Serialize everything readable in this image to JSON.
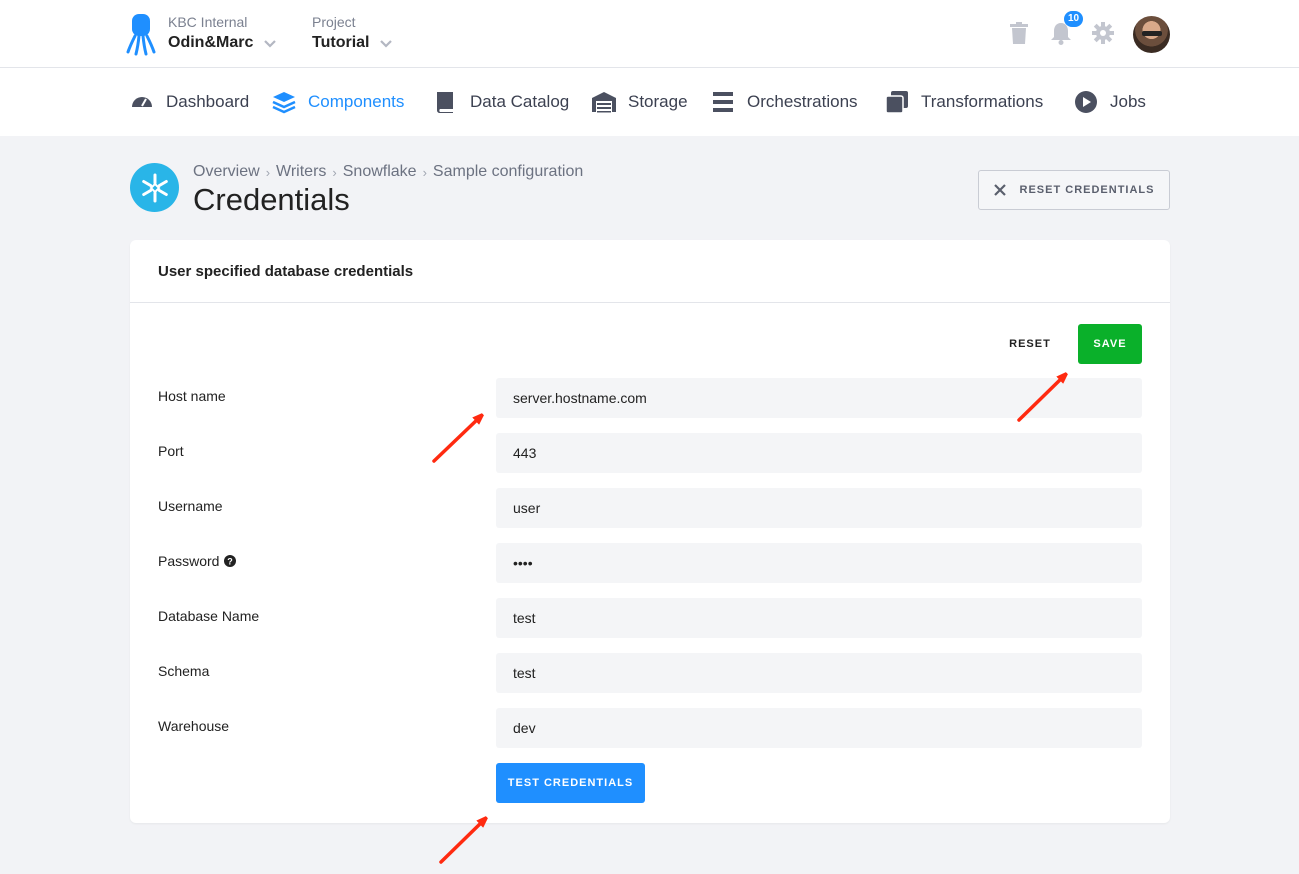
{
  "topbar": {
    "organization_label": "KBC Internal",
    "organization_name": "Odin&Marc",
    "project_label": "Project",
    "project_name": "Tutorial",
    "notifications_count": "10",
    "icons": [
      "trash-icon",
      "bell-icon",
      "gear-icon"
    ]
  },
  "nav": {
    "items": [
      {
        "label": "Dashboard",
        "icon": "gauge-icon"
      },
      {
        "label": "Components",
        "icon": "layers-icon"
      },
      {
        "label": "Data Catalog",
        "icon": "book-icon"
      },
      {
        "label": "Storage",
        "icon": "warehouse-icon"
      },
      {
        "label": "Orchestrations",
        "icon": "bars-icon"
      },
      {
        "label": "Transformations",
        "icon": "copy-icon"
      },
      {
        "label": "Jobs",
        "icon": "play-circle-icon"
      }
    ],
    "active": "Components"
  },
  "header": {
    "breadcrumb": [
      "Overview",
      "Writers",
      "Snowflake",
      "Sample configuration"
    ],
    "title": "Credentials",
    "reset_credentials_label": "RESET CREDENTIALS"
  },
  "card": {
    "title": "User specified database credentials",
    "reset_label": "RESET",
    "save_label": "SAVE",
    "fields": [
      {
        "label": "Host name",
        "value": "server.hostname.com"
      },
      {
        "label": "Port",
        "value": "443"
      },
      {
        "label": "Username",
        "value": "user"
      },
      {
        "label": "Password",
        "value": "••••"
      },
      {
        "label": "Database Name",
        "value": "test"
      },
      {
        "label": "Schema",
        "value": "test"
      },
      {
        "label": "Warehouse",
        "value": "dev"
      }
    ],
    "test_credentials_label": "TEST CREDENTIALS"
  },
  "colors": {
    "accent": "#1f8fff",
    "save": "#0ab02a",
    "annotation_arrow": "#ff2a10",
    "snowflake": "#29b5e8"
  }
}
